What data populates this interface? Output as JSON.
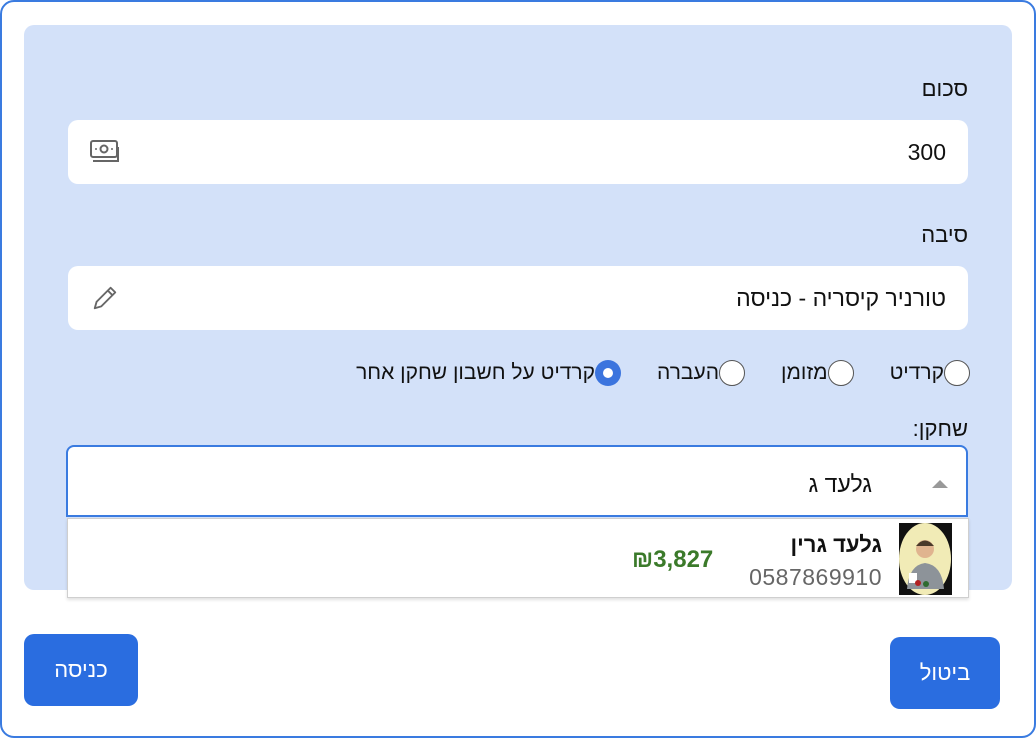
{
  "form": {
    "amount_label": "סכום",
    "amount_value": "300",
    "reason_label": "סיבה",
    "reason_value": "טורניר קיסריה - כניסה",
    "payment_options": [
      {
        "label": "קרדיט",
        "checked": false
      },
      {
        "label": "מזומן",
        "checked": false
      },
      {
        "label": "העברה",
        "checked": false
      },
      {
        "label": "קרדיט על חשבון שחקן אחר",
        "checked": true
      }
    ],
    "player_label": "שחקן:",
    "player_value": "גלעד ג"
  },
  "dropdown": {
    "option": {
      "name": "גלעד גרין",
      "phone": "0587869910",
      "balance": "₪3,827"
    }
  },
  "buttons": {
    "cancel": "ביטול",
    "submit": "כניסה"
  },
  "colors": {
    "accent": "#2a6de0",
    "panel": "#d3e1f9",
    "balance": "#3b7a2a"
  }
}
